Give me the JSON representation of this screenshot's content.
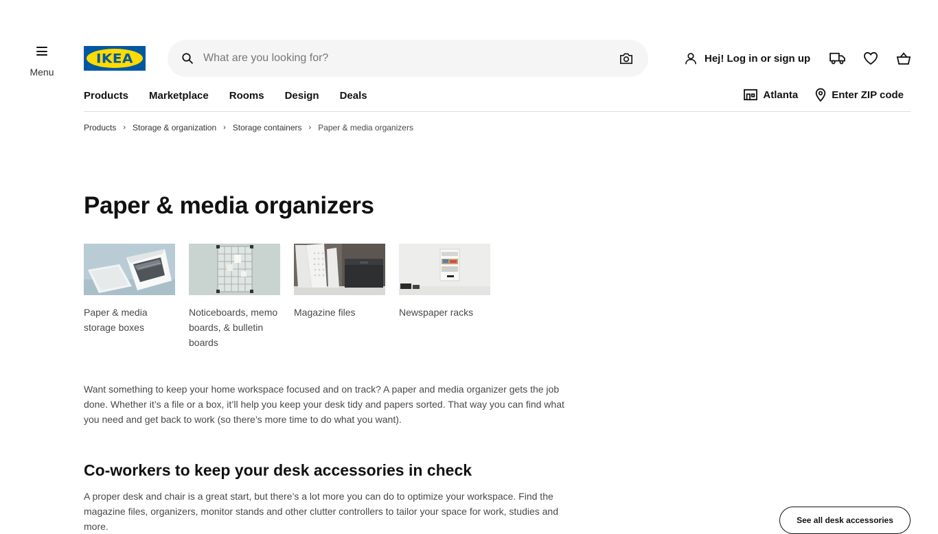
{
  "header": {
    "menu_label": "Menu",
    "logo_text": "IKEA",
    "search_placeholder": "What are you looking for?",
    "account_label": "Hej! Log in or sign up",
    "icons": [
      "menu-icon",
      "search-icon",
      "camera-icon",
      "user-icon",
      "truck-icon",
      "heart-icon",
      "basket-icon",
      "store-icon",
      "location-pin-icon"
    ]
  },
  "nav": {
    "items": [
      "Products",
      "Marketplace",
      "Rooms",
      "Design",
      "Deals"
    ],
    "store": "Atlanta",
    "zip": "Enter ZIP code"
  },
  "breadcrumb": [
    "Products",
    "Storage & organization",
    "Storage containers",
    "Paper & media organizers"
  ],
  "page": {
    "title": "Paper & media organizers",
    "categories": [
      {
        "label": "Paper & media storage boxes"
      },
      {
        "label": "Noticeboards, memo boards, & bulletin boards"
      },
      {
        "label": "Magazine files"
      },
      {
        "label": "Newspaper racks"
      }
    ],
    "intro": "Want something to keep your home workspace focused and on track? A paper and media organizer gets the job done. Whether it’s a file or a box, it’ll help you keep your desk tidy and papers sorted. That way you can find what you need and get back to work (so there’s more time to do what you want).",
    "section": {
      "title": "Co-workers to keep your desk accessories in check",
      "text": "A proper desk and chair is a great start, but there’s a lot more you can do to optimize your workspace. Find the magazine files, organizers, monitor stands and other clutter controllers to tailor your space for work, studies and more.",
      "button": "See all desk accessories"
    }
  },
  "colors": {
    "brand_blue": "#0058a3",
    "brand_yellow": "#ffdb00",
    "text_primary": "#111111",
    "text_secondary": "#484848",
    "search_bg": "#f5f5f5"
  }
}
